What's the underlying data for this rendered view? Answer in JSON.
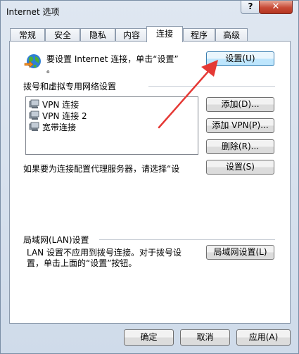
{
  "window": {
    "title": "Internet 选项",
    "help": "?",
    "close": "✕"
  },
  "tabs": [
    "常规",
    "安全",
    "隐私",
    "内容",
    "连接",
    "程序",
    "高级"
  ],
  "setup": {
    "text1": "要设置 Internet 连接，单击“设置”",
    "text2": "。",
    "button": "设置(U)"
  },
  "dialup": {
    "section_title": "拨号和虚拟专用网络设置",
    "items": [
      "VPN 连接",
      "VPN 连接 2",
      "宽带连接"
    ],
    "add_button": "添加(D)...",
    "add_vpn_button": "添加 VPN(P)...",
    "remove_button": "删除(R)...",
    "proxy_text": "如果要为连接配置代理服务器，请选择“设",
    "settings_button": "设置(S)"
  },
  "lan": {
    "section_title": "局域网(LAN)设置",
    "text1": "LAN 设置不应用到拨号连接。对于拨号设",
    "text2": "置，单击上面的“设置”按钮。",
    "button": "局域网设置(L)"
  },
  "footer": {
    "ok": "确定",
    "cancel": "取消",
    "apply": "应用(A)"
  },
  "colors": {
    "arrow": "#e53935"
  }
}
